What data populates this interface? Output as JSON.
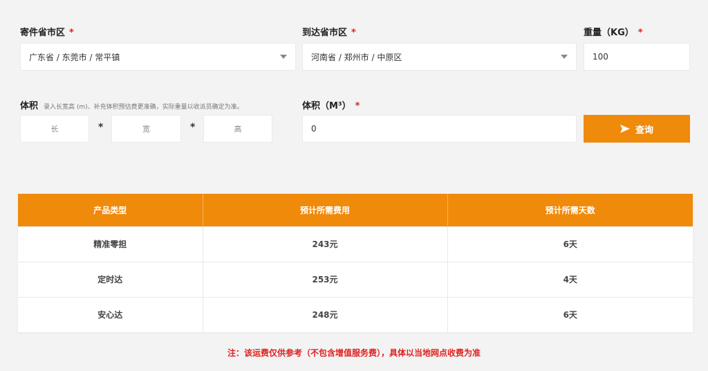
{
  "origin": {
    "label": "寄件省市区",
    "required": "*",
    "value": "广东省 / 东莞市 / 常平镇"
  },
  "destination": {
    "label": "到达省市区",
    "required": "*",
    "value": "河南省 / 郑州市 / 中原区"
  },
  "weight": {
    "label": "重量（KG）",
    "required": "*",
    "value": "100"
  },
  "dimensions": {
    "label": "体积",
    "hint": "录入长宽高 (m)、补充体积预估费更准确，实际重量以收派员确定为准。",
    "length_placeholder": "长",
    "width_placeholder": "宽",
    "height_placeholder": "高",
    "times": "*"
  },
  "volume": {
    "label": "体积（M³）",
    "required": "*",
    "value": "0"
  },
  "query_button": {
    "label": "查询",
    "icon": "send-icon",
    "color": "#f08a0b"
  },
  "table": {
    "headers": [
      "产品类型",
      "预计所需费用",
      "预计所需天数"
    ],
    "rows": [
      [
        "精准零担",
        "243元",
        "6天"
      ],
      [
        "定时达",
        "253元",
        "4天"
      ],
      [
        "安心达",
        "248元",
        "6天"
      ]
    ]
  },
  "note": "注：该运费仅供参考（不包含增值服务费），具体以当地网点收费为准"
}
